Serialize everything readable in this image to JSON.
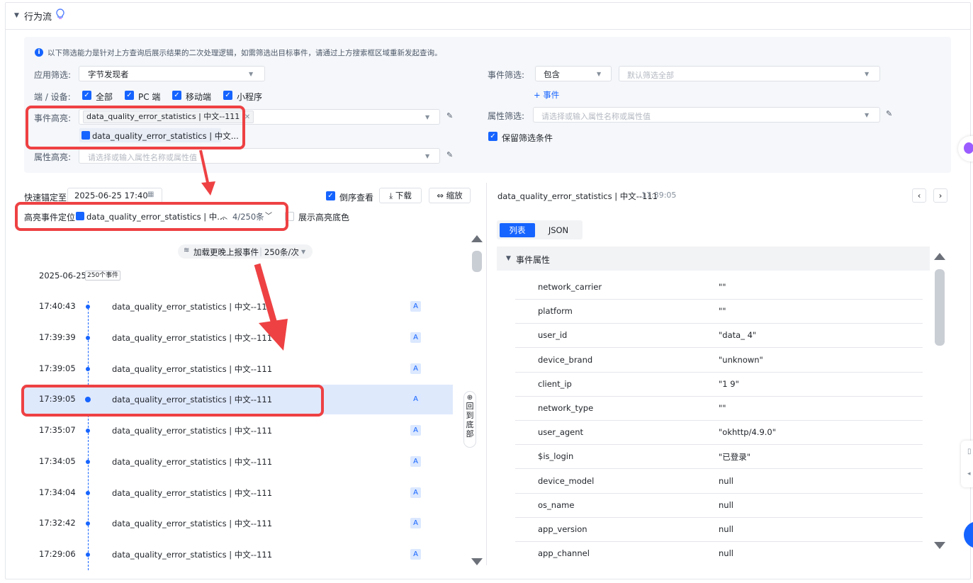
{
  "section": {
    "title": "行为流"
  },
  "notice": "以下筛选能力是针对上方查询后展示结果的二次处理逻辑，如需筛选出目标事件，请通过上方搜索框区域重新发起查询。",
  "filters": {
    "app_label": "应用筛选:",
    "app_value": "字节发现者",
    "device_label": "端 / 设备:",
    "devices": [
      "全部",
      "PC 端",
      "移动端",
      "小程序"
    ],
    "event_hl_label": "事件高亮:",
    "event_hl_tag": "data_quality_error_statistics | 中文--111",
    "event_hl_chip": "data_quality_error_statistics | 中文...",
    "prop_hl_label": "属性高亮:",
    "prop_hl_placeholder": "请选择或输入属性名称或属性值",
    "event_filter_label": "事件筛选:",
    "event_filter_op": "包含",
    "event_filter_placeholder": "默认筛选全部",
    "add_event": "+ 事件",
    "prop_filter_label": "属性筛选:",
    "prop_filter_placeholder": "请选择或输入属性名称或属性值",
    "keep_filter": "保留筛选条件"
  },
  "toolbar": {
    "quick_locate_label": "快速锚定至",
    "quick_locate_value": "2025-06-25 17:40",
    "reverse_label": "倒序查看",
    "download": "下载",
    "zoom": "缩放",
    "locate_label": "高亮事件定位",
    "locate_value": "data_quality_error_statistics | 中...",
    "locate_count": "4/250条",
    "show_bg": "展示高亮底色"
  },
  "timeline": {
    "load_more": "加载更晚上报事件",
    "per_page": "250条/次",
    "date": "2025-06-25",
    "count_badge": "250个事件",
    "back_bottom": "回到底部",
    "events": [
      {
        "time": "17:40:43",
        "name": "data_quality_error_statistics | 中文--111",
        "badge": "A"
      },
      {
        "time": "17:39:39",
        "name": "data_quality_error_statistics | 中文--111",
        "badge": "A"
      },
      {
        "time": "17:39:05",
        "name": "data_quality_error_statistics | 中文--111",
        "badge": "A"
      },
      {
        "time": "17:39:05",
        "name": "data_quality_error_statistics | 中文--111",
        "badge": "A"
      },
      {
        "time": "17:35:07",
        "name": "data_quality_error_statistics | 中文--111",
        "badge": "A"
      },
      {
        "time": "17:34:05",
        "name": "data_quality_error_statistics | 中文--111",
        "badge": "A"
      },
      {
        "time": "17:34:04",
        "name": "data_quality_error_statistics | 中文--111",
        "badge": "A"
      },
      {
        "time": "17:32:42",
        "name": "data_quality_error_statistics | 中文--111",
        "badge": "A"
      },
      {
        "time": "17:29:06",
        "name": "data_quality_error_statistics | 中文--111",
        "badge": "A"
      }
    ]
  },
  "detail": {
    "title": "data_quality_error_statistics | 中文--111",
    "time": "17:39:05",
    "tab_list": "列表",
    "tab_json": "JSON",
    "section": "事件属性",
    "props": [
      {
        "key": "network_carrier",
        "value": "\"\""
      },
      {
        "key": "platform",
        "value": "\"\""
      },
      {
        "key": "user_id",
        "value": "\"data_ 4\""
      },
      {
        "key": "device_brand",
        "value": "\"unknown\""
      },
      {
        "key": "client_ip",
        "value": "\"1 9\""
      },
      {
        "key": "network_type",
        "value": "\"\""
      },
      {
        "key": "user_agent",
        "value": "\"okhttp/4.9.0\""
      },
      {
        "key": "$is_login",
        "value": "\"已登录\""
      },
      {
        "key": "device_model",
        "value": "null"
      },
      {
        "key": "os_name",
        "value": "null"
      },
      {
        "key": "app_version",
        "value": "null"
      },
      {
        "key": "app_channel",
        "value": "null"
      }
    ]
  },
  "colors": {
    "accent": "#1664ff",
    "annotation": "#ee4143",
    "highlight_row": "#dfe9fc"
  }
}
